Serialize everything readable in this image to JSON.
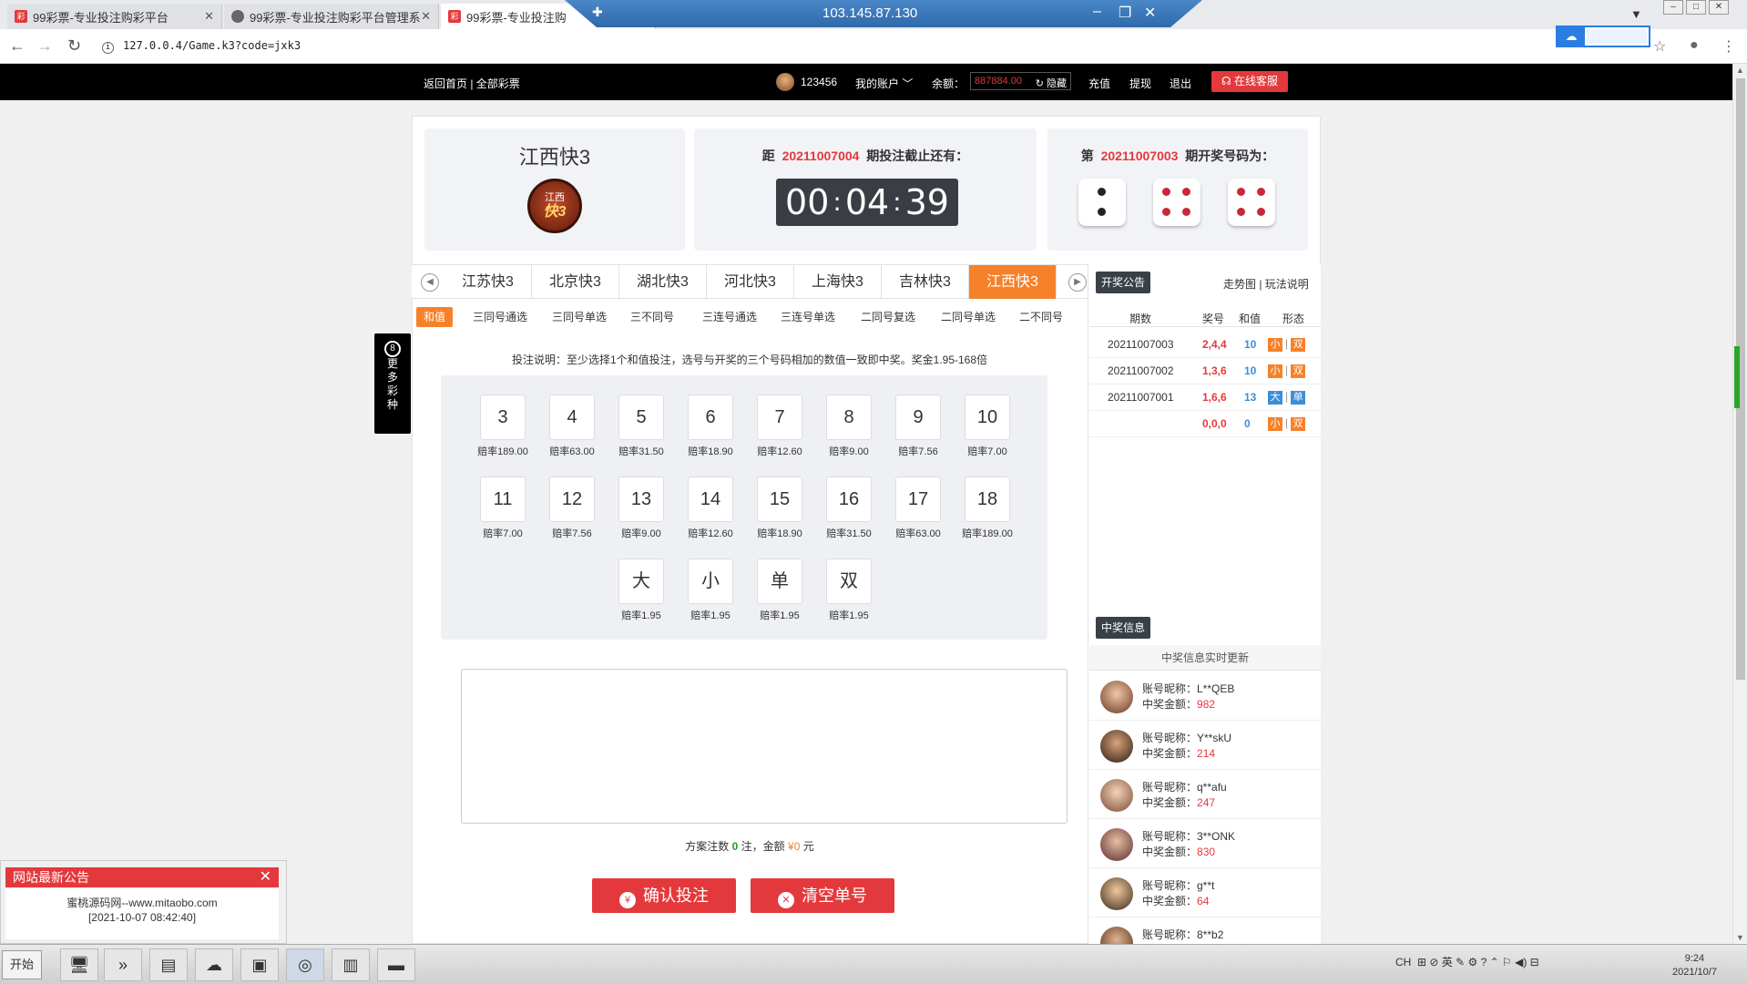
{
  "browser": {
    "tabs": [
      {
        "title": "99彩票-专业投注购彩平台",
        "favicon": "lottery-favicon"
      },
      {
        "title": "99彩票-专业投注购彩平台管理系",
        "favicon": "globe-icon"
      },
      {
        "title": "99彩票-专业投注购",
        "favicon": "lottery-favicon"
      }
    ],
    "remote_ip": "103.145.87.130",
    "url": "127.0.0.4/Game.k3?code=jxk3"
  },
  "site": {
    "nav_left": "返回首页 | 全部彩票",
    "user_id": "123456",
    "my_account": "我的账户",
    "balance_label": "余额：",
    "balance_value": "887884.00",
    "hide_label": "隐藏",
    "recharge": "充值",
    "withdraw": "提现",
    "logout": "退出",
    "service": "在线客服"
  },
  "game": {
    "name": "江西快3",
    "logo_top": "江西",
    "logo_main": "快3",
    "deadline_prefix": "距",
    "deadline_period": "20211007004",
    "deadline_suffix": "期投注截止还有：",
    "timer": {
      "h": "00",
      "m": "04",
      "s": "39"
    },
    "draw_prefix": "第",
    "draw_period": "20211007003",
    "draw_suffix": "期开奖号码为：",
    "dice": [
      2,
      4,
      4
    ]
  },
  "lottery_tabs": [
    "江苏快3",
    "北京快3",
    "湖北快3",
    "河北快3",
    "上海快3",
    "吉林快3",
    "江西快3"
  ],
  "lottery_active": "江西快3",
  "play_tabs": [
    "和值",
    "三同号通选",
    "三同号单选",
    "三不同号",
    "三连号通选",
    "三连号单选",
    "二同号复选",
    "二同号单选",
    "二不同号"
  ],
  "hint": "投注说明：至少选择1个和值投注，选号与开奖的三个号码相加的数值一致即中奖。奖金1.95-168倍",
  "numbers": [
    {
      "n": "3",
      "odds": "赔率189.00"
    },
    {
      "n": "4",
      "odds": "赔率63.00"
    },
    {
      "n": "5",
      "odds": "赔率31.50"
    },
    {
      "n": "6",
      "odds": "赔率18.90"
    },
    {
      "n": "7",
      "odds": "赔率12.60"
    },
    {
      "n": "8",
      "odds": "赔率9.00"
    },
    {
      "n": "9",
      "odds": "赔率7.56"
    },
    {
      "n": "10",
      "odds": "赔率7.00"
    },
    {
      "n": "11",
      "odds": "赔率7.00"
    },
    {
      "n": "12",
      "odds": "赔率7.56"
    },
    {
      "n": "13",
      "odds": "赔率9.00"
    },
    {
      "n": "14",
      "odds": "赔率12.60"
    },
    {
      "n": "15",
      "odds": "赔率18.90"
    },
    {
      "n": "16",
      "odds": "赔率31.50"
    },
    {
      "n": "17",
      "odds": "赔率63.00"
    },
    {
      "n": "18",
      "odds": "赔率189.00"
    },
    {
      "n": "大",
      "odds": "赔率1.95"
    },
    {
      "n": "小",
      "odds": "赔率1.95"
    },
    {
      "n": "单",
      "odds": "赔率1.95"
    },
    {
      "n": "双",
      "odds": "赔率1.95"
    }
  ],
  "summary": {
    "prefix": "方案注数",
    "count": "0",
    "mid": "注，金额",
    "amount": "¥0",
    "suffix": "元"
  },
  "buttons": {
    "confirm": "确认投注",
    "clear": "清空单号"
  },
  "right": {
    "announce_btn": "开奖公告",
    "links": "走势图 | 玩法说明",
    "headers": [
      "期数",
      "奖号",
      "和值",
      "形态"
    ],
    "rows": [
      {
        "period": "20211007003",
        "nums": "2,4,4",
        "sum": "10",
        "size": "小",
        "parity": "双"
      },
      {
        "period": "20211007002",
        "nums": "1,3,6",
        "sum": "10",
        "size": "小",
        "parity": "双"
      },
      {
        "period": "20211007001",
        "nums": "1,6,6",
        "sum": "13",
        "size": "大",
        "parity": "单"
      },
      {
        "period": "",
        "nums": "0,0,0",
        "sum": "0",
        "size": "小",
        "parity": "双"
      }
    ],
    "win_btn": "中奖信息",
    "win_header": "中奖信息实时更新",
    "winners": [
      {
        "name": "账号昵称：L**QEB",
        "amount_label": "中奖金额：",
        "amount": "982"
      },
      {
        "name": "账号昵称：Y**skU",
        "amount_label": "中奖金额：",
        "amount": "214"
      },
      {
        "name": "账号昵称：q**afu",
        "amount_label": "中奖金额：",
        "amount": "247"
      },
      {
        "name": "账号昵称：3**ONK",
        "amount_label": "中奖金额：",
        "amount": "830"
      },
      {
        "name": "账号昵称：g**t",
        "amount_label": "中奖金额：",
        "amount": "64"
      },
      {
        "name": "账号昵称：8**b2",
        "amount_label": "",
        "amount": ""
      }
    ]
  },
  "side_more": "更多彩种",
  "notice": {
    "title": "网站最新公告",
    "line1": "蜜桃源码网--www.mitaobo.com",
    "line2": "[2021-10-07 08:42:40]"
  },
  "taskbar": {
    "start": "开始",
    "tray_lang": "CH",
    "time": "9:24",
    "date": "2021/10/7"
  },
  "colors": {
    "accent": "#f5822b",
    "red": "#e4393c",
    "blue": "#3b8fd8",
    "green": "#1aa01a"
  }
}
